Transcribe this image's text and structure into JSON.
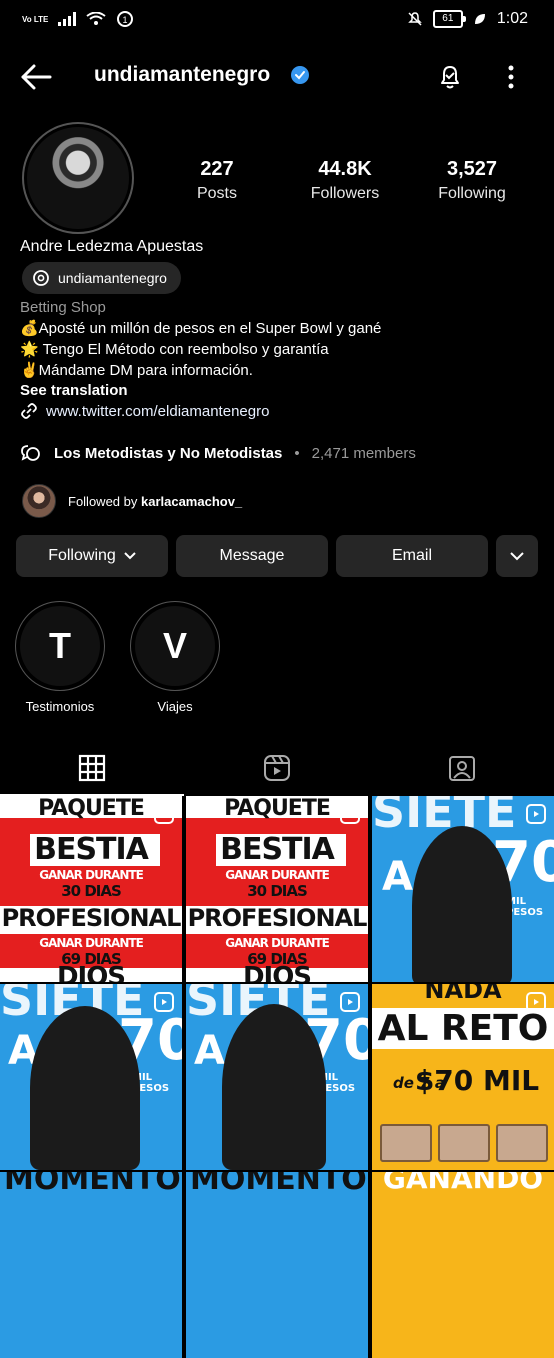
{
  "status_bar": {
    "carrier": "Vo LTE",
    "battery": "61",
    "time": "1:02"
  },
  "header": {
    "username": "undiamantenegro"
  },
  "profile": {
    "stats": [
      {
        "value": "227",
        "label": "Posts"
      },
      {
        "value": "44.8K",
        "label": "Followers"
      },
      {
        "value": "3,527",
        "label": "Following"
      }
    ],
    "name": "Andre Ledezma Apuestas",
    "threads_handle": "undiamantenegro",
    "category": "Betting Shop",
    "bio": [
      "💰Aposté un millón de pesos en el Super Bowl y gané",
      "🌟 Tengo El Método con reembolso y garantía",
      "✌️Mándame DM para información."
    ],
    "see_translation": "See translation",
    "link": "www.twitter.com/eldiamantenegro",
    "community": {
      "name": "Los Metodistas y No Metodistas",
      "separator": "•",
      "members": "2,471 members"
    },
    "followed_by_prefix": "Followed by ",
    "followed_by_user": "karlacamachov_"
  },
  "actions": {
    "following": "Following",
    "message": "Message",
    "email": "Email"
  },
  "highlights": [
    {
      "letter": "T",
      "label": "Testimonios"
    },
    {
      "letter": "V",
      "label": "Viajes"
    }
  ],
  "posts": {
    "red1": {
      "top": "PAQUETE",
      "l1": "BESTIA",
      "l2": "GANAR DURANTE",
      "l3": "30 DIAS",
      "l4": "PROFESIONAL",
      "l5": "GANAR DURANTE",
      "l6": "69 DIAS",
      "l7": "DIOS"
    },
    "red2": {
      "top": "PAQUETE",
      "l1": "BESTIA",
      "l2": "GANAR DURANTE",
      "l3": "30 DIAS",
      "l4": "PROFESIONAL",
      "l5": "GANAR DURANTE",
      "l6": "69 DIAS",
      "l7": "DIOS"
    },
    "blue1": {
      "a": "A",
      "num": "70",
      "sub": "MIL PESOS",
      "top": "SIETE"
    },
    "blue2": {
      "a": "A",
      "num": "70",
      "sub": "MIL PESOS",
      "top": "SIETE",
      "bottom": "MOMENTO"
    },
    "blue3": {
      "a": "A",
      "num": "70",
      "sub": "MIL PESOS",
      "top": "SIETE",
      "bottom": "MOMENTO"
    },
    "yellow": {
      "top": "NADA",
      "l1": "AL RETO",
      "l2": "de 7 a",
      "l3": "$70 MIL",
      "bottom": "GANANDO"
    }
  },
  "colors": {
    "accent_blue": "#3797f0",
    "red": "#e41f1f",
    "blue": "#2b9be3",
    "yellow": "#f7b51a"
  }
}
